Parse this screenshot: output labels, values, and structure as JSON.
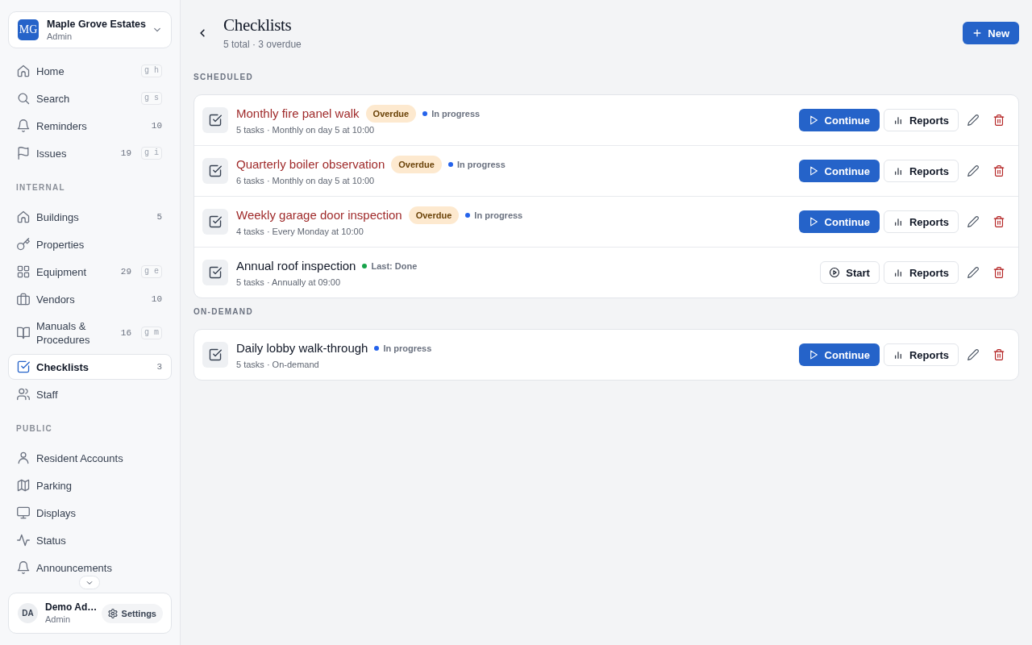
{
  "sidebar": {
    "workspace": {
      "initials": "MG",
      "name": "Maple Grove Estates",
      "role": "Admin"
    },
    "sections": [
      {
        "items": [
          {
            "label": "Home",
            "shortcut": "g h",
            "selected": false
          },
          {
            "label": "Search",
            "shortcut": "g s",
            "selected": false
          },
          {
            "label": "Reminders",
            "count": "10",
            "selected": false
          },
          {
            "label": "Issues",
            "count": "19",
            "shortcut": "g i",
            "selected": false
          }
        ]
      },
      {
        "heading": "INTERNAL",
        "items": [
          {
            "label": "Buildings",
            "count": "5",
            "selected": false
          },
          {
            "label": "Properties",
            "selected": false
          },
          {
            "label": "Equipment",
            "count": "29",
            "shortcut": "g e",
            "selected": false
          },
          {
            "label": "Vendors",
            "count": "10",
            "selected": false
          },
          {
            "label": "Manuals & Procedures",
            "count": "16",
            "shortcut": "g m",
            "selected": false
          },
          {
            "label": "Checklists",
            "count": "3",
            "selected": true
          },
          {
            "label": "Staff",
            "selected": false
          }
        ]
      },
      {
        "heading": "PUBLIC",
        "items": [
          {
            "label": "Resident Accounts",
            "selected": false
          },
          {
            "label": "Parking",
            "selected": false
          },
          {
            "label": "Displays",
            "selected": false
          },
          {
            "label": "Status",
            "selected": false
          },
          {
            "label": "Announcements",
            "selected": false
          }
        ]
      }
    ],
    "user": {
      "initials": "DA",
      "name": "Demo Ad…",
      "role": "Admin"
    },
    "settings_button": "Settings"
  },
  "header": {
    "title": "Checklists",
    "subtitle": "5 total · 3 overdue",
    "new_button": "New"
  },
  "groups": [
    {
      "heading": "SCHEDULED",
      "items": [
        {
          "title": "Monthly fire panel walk",
          "overdue": true,
          "badge": "Overdue",
          "status": {
            "label": "In progress",
            "color": "#2563eb"
          },
          "meta": "5 tasks · Monthly on day 5 at 10:00",
          "action": {
            "kind": "continue",
            "label": "Continue"
          },
          "reports": "Reports"
        },
        {
          "title": "Quarterly boiler observation",
          "overdue": true,
          "badge": "Overdue",
          "status": {
            "label": "In progress",
            "color": "#2563eb"
          },
          "meta": "6 tasks · Monthly on day 5 at 10:00",
          "action": {
            "kind": "continue",
            "label": "Continue"
          },
          "reports": "Reports"
        },
        {
          "title": "Weekly garage door inspection",
          "overdue": true,
          "badge": "Overdue",
          "status": {
            "label": "In progress",
            "color": "#2563eb"
          },
          "meta": "4 tasks · Every Monday at 10:00",
          "action": {
            "kind": "continue",
            "label": "Continue"
          },
          "reports": "Reports"
        },
        {
          "title": "Annual roof inspection",
          "overdue": false,
          "status": {
            "label": "Last: Done",
            "color": "#16a34a"
          },
          "meta": "5 tasks · Annually at 09:00",
          "action": {
            "kind": "start",
            "label": "Start"
          },
          "reports": "Reports"
        }
      ]
    },
    {
      "heading": "ON-DEMAND",
      "items": [
        {
          "title": "Daily lobby walk-through",
          "overdue": false,
          "status": {
            "label": "In progress",
            "color": "#2563eb"
          },
          "meta": "5 tasks · On-demand",
          "action": {
            "kind": "continue",
            "label": "Continue"
          },
          "reports": "Reports"
        }
      ]
    }
  ]
}
